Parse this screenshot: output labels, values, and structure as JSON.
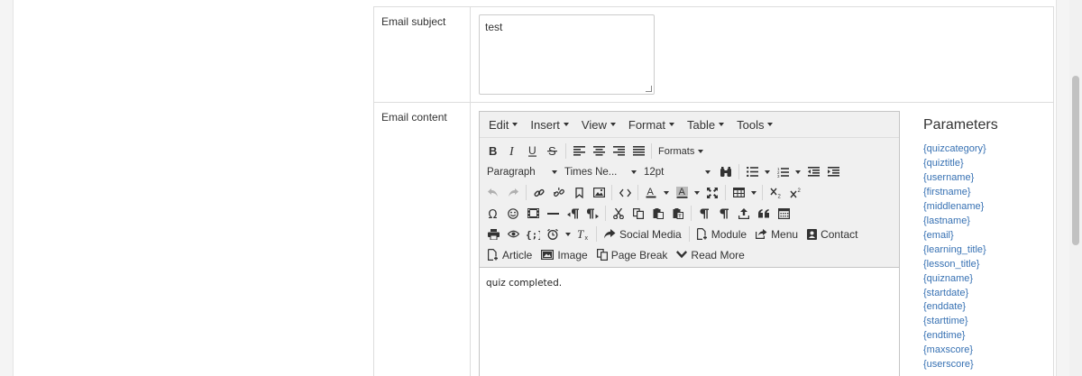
{
  "form": {
    "subject_label": "Email subject",
    "subject_value": "test",
    "content_label": "Email content"
  },
  "editor": {
    "menus": [
      "Edit",
      "Insert",
      "View",
      "Format",
      "Table",
      "Tools"
    ],
    "formats_label": "Formats",
    "block_format": "Paragraph",
    "font_family": "Times Ne...",
    "font_size": "12pt",
    "buttons": {
      "social_media": "Social Media",
      "module": "Module",
      "menu": "Menu",
      "contact": "Contact",
      "article": "Article",
      "image": "Image",
      "page_break": "Page Break",
      "read_more": "Read More"
    },
    "content_text": "quiz completed."
  },
  "parameters": {
    "title": "Parameters",
    "items": [
      "{quizcategory}",
      "{quiztitle}",
      "{username}",
      "{firstname}",
      "{middlename}",
      "{lastname}",
      "{email}",
      "{learning_title}",
      "{lesson_title}",
      "{quizname}",
      "{startdate}",
      "{enddate}",
      "{starttime}",
      "{endtime}",
      "{maxscore}",
      "{userscore}"
    ]
  },
  "colors": {
    "link": "#3771b3",
    "toolbar_bg": "#f0f0f0",
    "border": "#dddddd"
  }
}
